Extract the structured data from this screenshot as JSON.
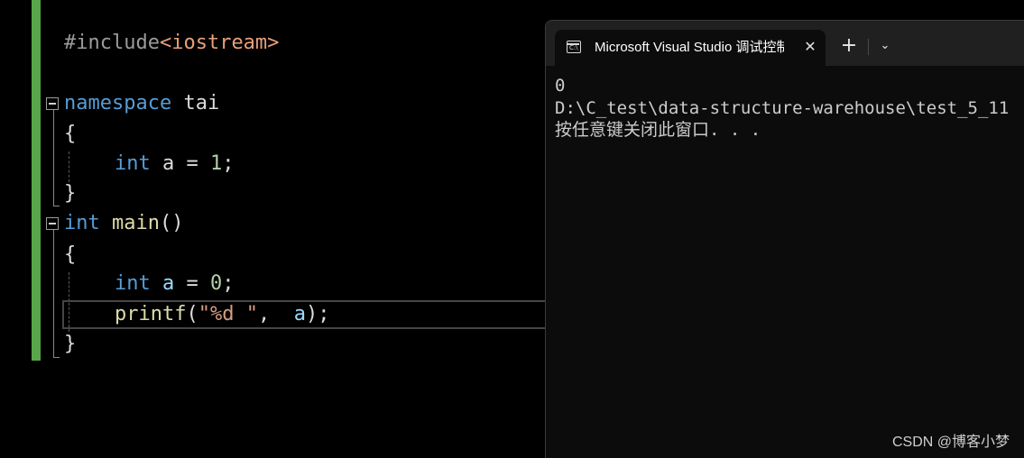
{
  "editor": {
    "line_include": {
      "directive": "#include",
      "header": "<iostream>"
    },
    "line_namespace": {
      "keyword": "namespace",
      "name": " tai"
    },
    "ns_open": "{",
    "ns_body": {
      "type": "int",
      "var": " a",
      "op": " = ",
      "value": "1",
      "end": ";"
    },
    "ns_close": "}",
    "line_main": {
      "type": "int",
      "space": " ",
      "name": "main",
      "parens": "()"
    },
    "main_open": "{",
    "main_decl": {
      "type": "int",
      "var": " a",
      "op": " = ",
      "value": "0",
      "end": ";"
    },
    "main_printf": {
      "fn": "printf",
      "open": "(",
      "str": "\"%d \"",
      "comma": ",  ",
      "arg": "a",
      "close": ");"
    },
    "main_close": "}"
  },
  "console": {
    "tab_title": "Microsoft Visual Studio 调试控制台",
    "tab_icon_label": "C:\\",
    "close_glyph": "✕",
    "new_tab_glyph": "+",
    "dropdown_glyph": "⌄",
    "output": [
      "0",
      "D:\\C_test\\data-structure-warehouse\\test_5_11",
      "按任意键关闭此窗口. . ."
    ]
  },
  "watermark": "CSDN @博客小梦",
  "colors": {
    "change_bar": "#57a64a",
    "keyword": "#569cd6",
    "function": "#dcdcaa",
    "string": "#d69d85",
    "number": "#b5cea8",
    "variable": "#9cdcfe"
  },
  "icons": {
    "tab": "terminal-icon",
    "close": "close-icon",
    "new_tab": "plus-icon",
    "dropdown": "chevron-down-icon",
    "fold": "collapse-icon"
  }
}
